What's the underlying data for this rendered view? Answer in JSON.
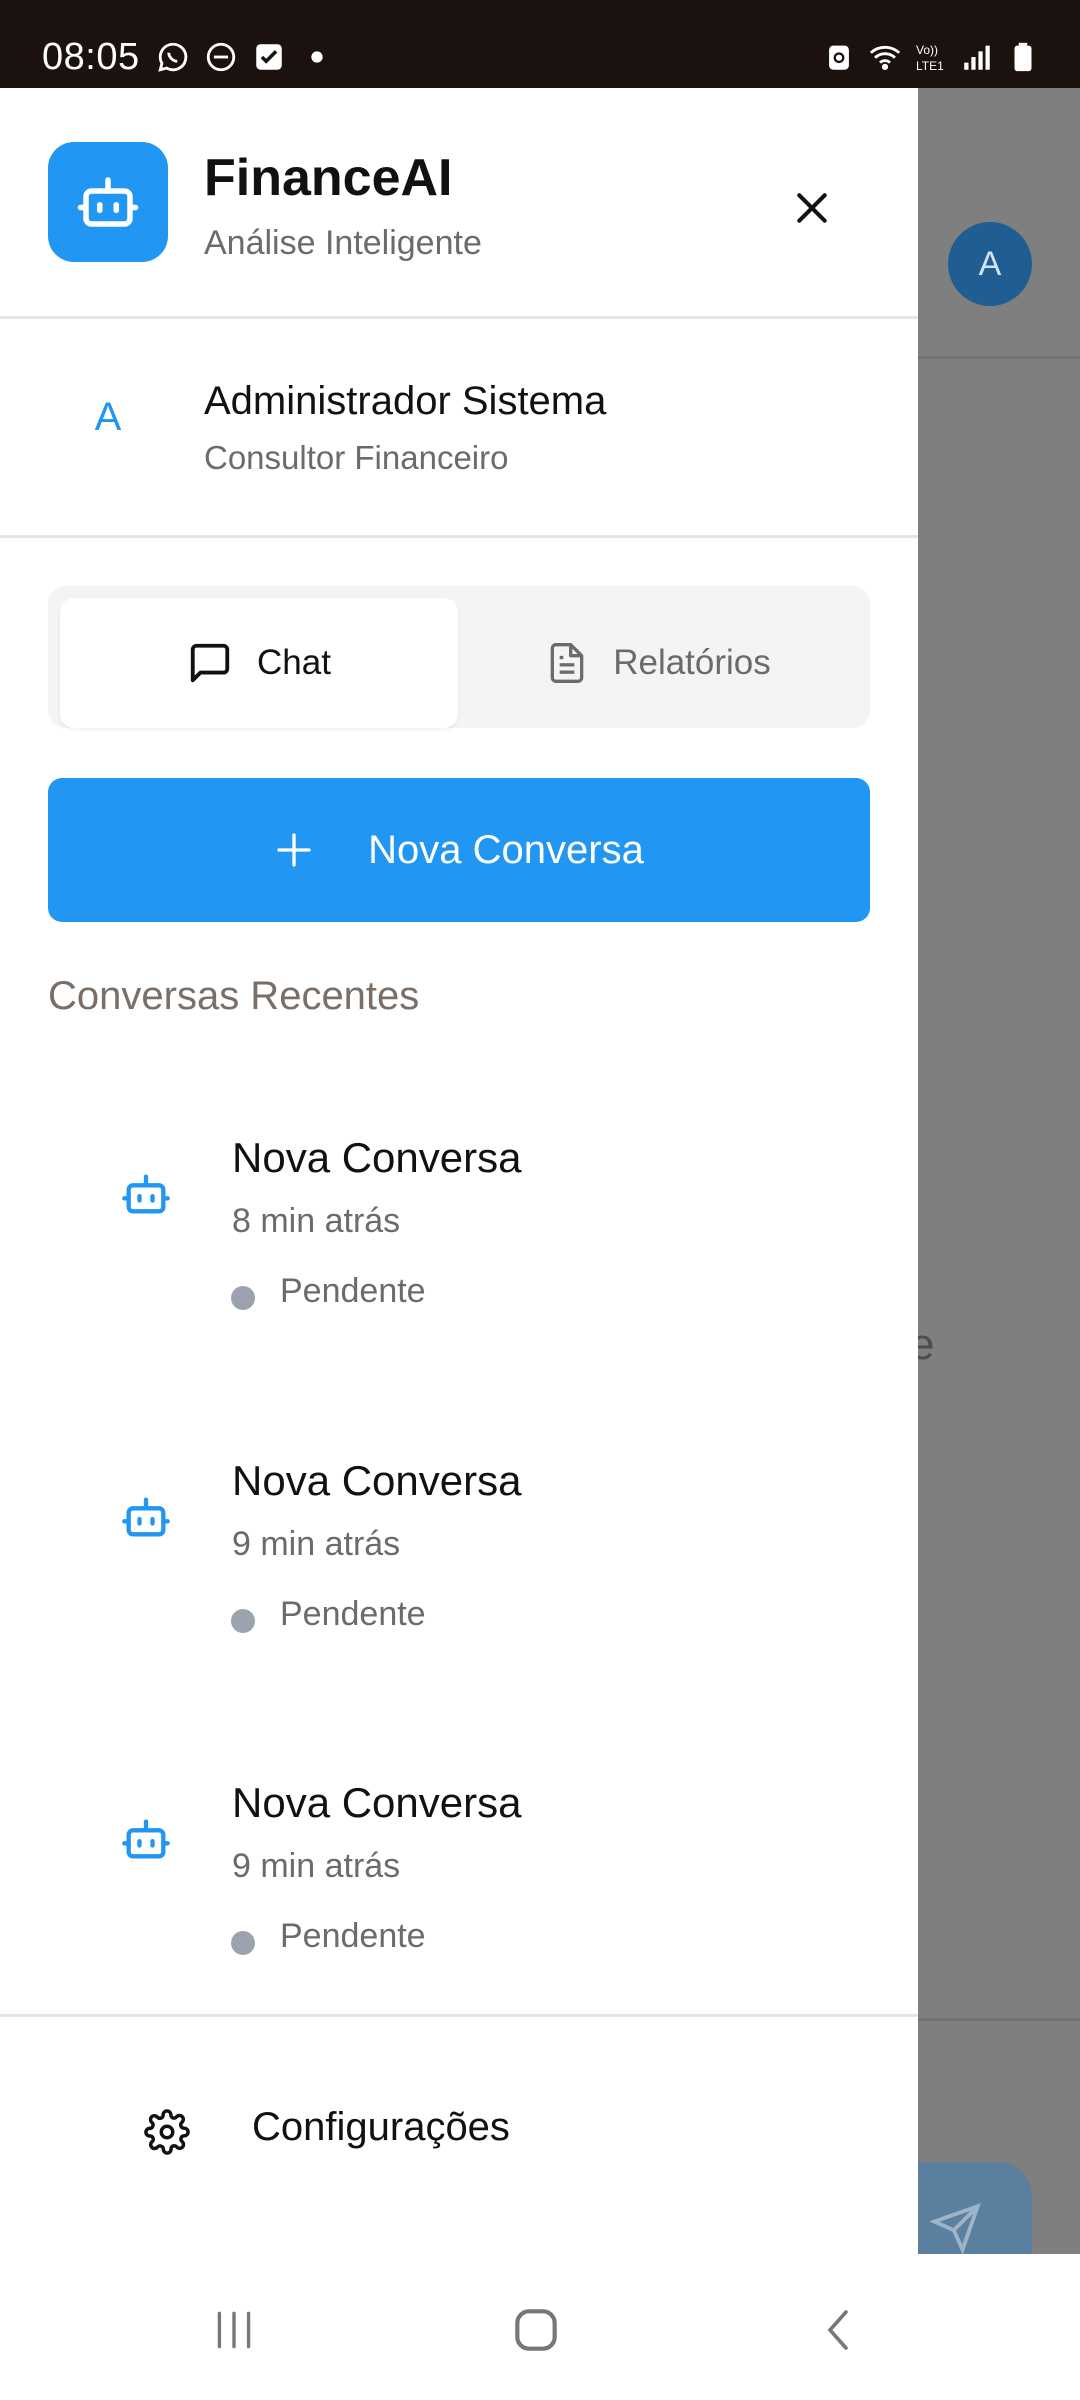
{
  "status_bar": {
    "time": "08:05",
    "left_icons": [
      "whatsapp-icon",
      "do-not-disturb-icon",
      "checkbox-icon",
      "dot-icon"
    ],
    "right_icons": [
      "battery-saver-icon",
      "wifi-icon",
      "volte-icon",
      "signal-icon",
      "battery-icon"
    ],
    "network_label_1": "Vo))",
    "network_label_2": "LTE1"
  },
  "background_app": {
    "avatar_letter": "A",
    "partial_text": "e"
  },
  "drawer": {
    "header": {
      "app_title": "FinanceAI",
      "app_subtitle": "Análise Inteligente"
    },
    "user": {
      "avatar_letter": "A",
      "name": "Administrador Sistema",
      "role": "Consultor Financeiro"
    },
    "tabs": [
      {
        "label": "Chat",
        "icon": "chat-bubble-icon",
        "active": true
      },
      {
        "label": "Relatórios",
        "icon": "document-icon",
        "active": false
      }
    ],
    "new_conversation_label": "Nova Conversa",
    "recent_title": "Conversas Recentes",
    "conversations": [
      {
        "title": "Nova Conversa",
        "time": "8 min atrás",
        "status": "Pendente"
      },
      {
        "title": "Nova Conversa",
        "time": "9 min atrás",
        "status": "Pendente"
      },
      {
        "title": "Nova Conversa",
        "time": "9 min atrás",
        "status": "Pendente"
      }
    ],
    "settings_label": "Configurações"
  },
  "colors": {
    "accent": "#2196f3",
    "status_pending": "#9ca3af"
  }
}
